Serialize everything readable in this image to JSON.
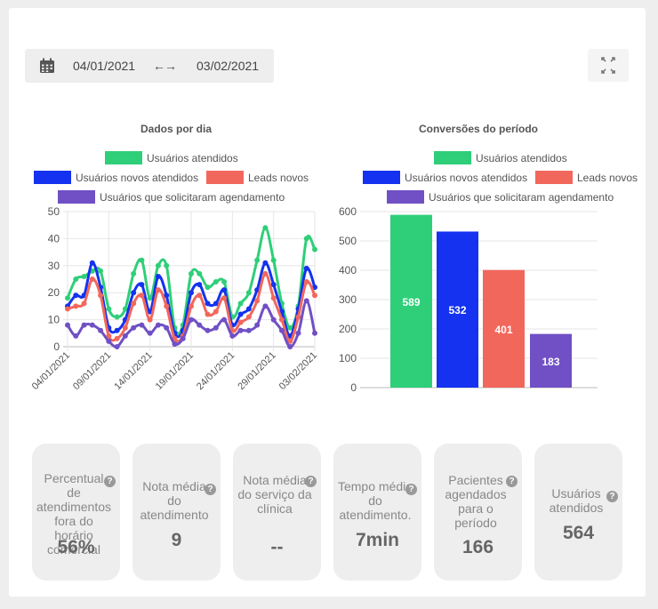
{
  "date_range": {
    "start": "04/01/2021",
    "end": "03/02/2021",
    "separator": "←→"
  },
  "icons": {
    "calendar": "calendar-icon",
    "expand": "fullscreen-icon",
    "help": "question-circle-icon"
  },
  "chart_data": [
    {
      "type": "line",
      "title": "Dados por dia",
      "legend_placement": "top",
      "x": [
        "04/01/2021",
        "05/01/2021",
        "06/01/2021",
        "07/01/2021",
        "08/01/2021",
        "09/01/2021",
        "10/01/2021",
        "11/01/2021",
        "12/01/2021",
        "13/01/2021",
        "14/01/2021",
        "15/01/2021",
        "16/01/2021",
        "17/01/2021",
        "18/01/2021",
        "19/01/2021",
        "20/01/2021",
        "21/01/2021",
        "22/01/2021",
        "23/01/2021",
        "24/01/2021",
        "25/01/2021",
        "26/01/2021",
        "27/01/2021",
        "28/01/2021",
        "29/01/2021",
        "30/01/2021",
        "31/01/2021",
        "01/02/2021",
        "02/02/2021",
        "03/02/2021"
      ],
      "x_tick_labels": [
        "04/01/2021",
        "09/01/2021",
        "14/01/2021",
        "19/01/2021",
        "24/01/2021",
        "29/01/2021",
        "03/02/2021"
      ],
      "x_tick_indices": [
        0,
        5,
        10,
        15,
        20,
        25,
        30
      ],
      "ylim": [
        0,
        50
      ],
      "yticks": [
        0,
        10,
        20,
        30,
        40,
        50
      ],
      "grid": true,
      "series": [
        {
          "name": "Usuários atendidos",
          "color": "#2ecf78",
          "values": [
            18,
            25,
            26,
            28,
            28,
            14,
            11,
            14,
            27,
            32,
            18,
            30,
            30,
            7,
            8,
            27,
            27,
            22,
            24,
            24,
            11,
            16,
            20,
            32,
            44,
            32,
            16,
            7,
            15,
            40,
            36
          ]
        },
        {
          "name": "Usuários novos atendidos",
          "color": "#1432ef",
          "values": [
            15,
            19,
            19,
            31,
            22,
            7,
            6,
            10,
            20,
            23,
            13,
            26,
            19,
            5,
            6,
            20,
            23,
            16,
            16,
            21,
            8,
            12,
            14,
            21,
            31,
            23,
            13,
            4,
            14,
            29,
            22
          ]
        },
        {
          "name": "Leads novos",
          "color": "#f2675c",
          "values": [
            14,
            15,
            16,
            25,
            19,
            4,
            3,
            7,
            16,
            19,
            10,
            21,
            15,
            3,
            4,
            15,
            19,
            12,
            13,
            18,
            6,
            9,
            11,
            17,
            27,
            18,
            10,
            2,
            11,
            24,
            19
          ]
        },
        {
          "name": "Usuários que solicitaram agendamento",
          "color": "#7050c4",
          "values": [
            8,
            4,
            8,
            8,
            6,
            2,
            0,
            4,
            7,
            8,
            5,
            8,
            7,
            1,
            3,
            10,
            8,
            6,
            7,
            10,
            4,
            6,
            6,
            8,
            15,
            10,
            6,
            0,
            5,
            17,
            5
          ]
        }
      ]
    },
    {
      "type": "bar",
      "title": "Conversões do período",
      "legend_placement": "top",
      "categories": [
        "Usuários atendidos",
        "Usuários novos atendidos",
        "Leads novos",
        "Usuários que solicitaram agendamento"
      ],
      "values": [
        589,
        532,
        401,
        183
      ],
      "value_labels": [
        "589",
        "532",
        "401",
        "183"
      ],
      "colors": [
        "#2ecf78",
        "#1432ef",
        "#f2675c",
        "#7050c4"
      ],
      "ylim": [
        0,
        600
      ],
      "yticks": [
        0,
        100,
        200,
        300,
        400,
        500,
        600
      ],
      "grid": true
    }
  ],
  "legend": {
    "items": [
      {
        "label": "Usuários atendidos",
        "color": "#2ecf78"
      },
      {
        "label": "Usuários novos atendidos",
        "color": "#1432ef"
      },
      {
        "label": "Leads novos",
        "color": "#f2675c"
      },
      {
        "label": "Usuários que solicitaram agendamento",
        "color": "#7050c4"
      }
    ]
  },
  "kpis": [
    {
      "label": "Percentual de atendimentos fora do horário comercial",
      "value": "56%"
    },
    {
      "label": "Nota média do atendimento",
      "value": "9"
    },
    {
      "label": "Nota média do serviço da clínica",
      "value": "--"
    },
    {
      "label": "Tempo médio do atendimento.",
      "value": "7min"
    },
    {
      "label": "Pacientes agendados para o período",
      "value": "166"
    },
    {
      "label": "Usuários atendidos",
      "value": "564"
    }
  ]
}
